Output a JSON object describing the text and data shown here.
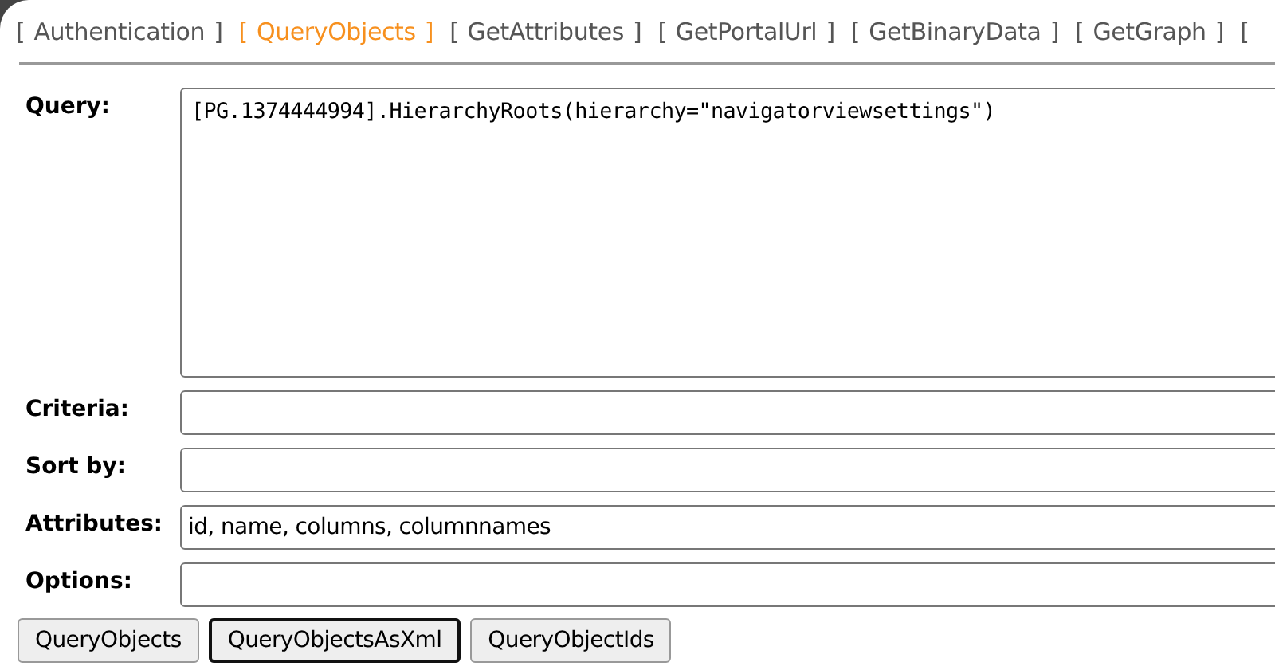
{
  "tabs": [
    {
      "label": "[ Authentication ]",
      "selected": false
    },
    {
      "label": "[ QueryObjects ]",
      "selected": true
    },
    {
      "label": "[ GetAttributes ]",
      "selected": false
    },
    {
      "label": "[ GetPortalUrl ]",
      "selected": false
    },
    {
      "label": "[ GetBinaryData ]",
      "selected": false
    },
    {
      "label": "[ GetGraph ]",
      "selected": false
    },
    {
      "label": "[",
      "selected": false
    }
  ],
  "fields": [
    {
      "label": "Query:",
      "kind": "textarea",
      "value": "[PG.1374444994].HierarchyRoots(hierarchy=\"navigatorviewsettings\")"
    },
    {
      "label": "Criteria:",
      "kind": "input"
    },
    {
      "label": "Sort by:",
      "kind": "input"
    },
    {
      "label": "Attributes:",
      "kind": "input",
      "value": "id, name, columns, columnnames"
    },
    {
      "label": "Options:",
      "kind": "input"
    }
  ],
  "buttons": [
    {
      "label": "QueryObjects",
      "focused": false
    },
    {
      "label": "QueryObjectsAsXml",
      "focused": true
    },
    {
      "label": "QueryObjectIds",
      "focused": false
    }
  ]
}
